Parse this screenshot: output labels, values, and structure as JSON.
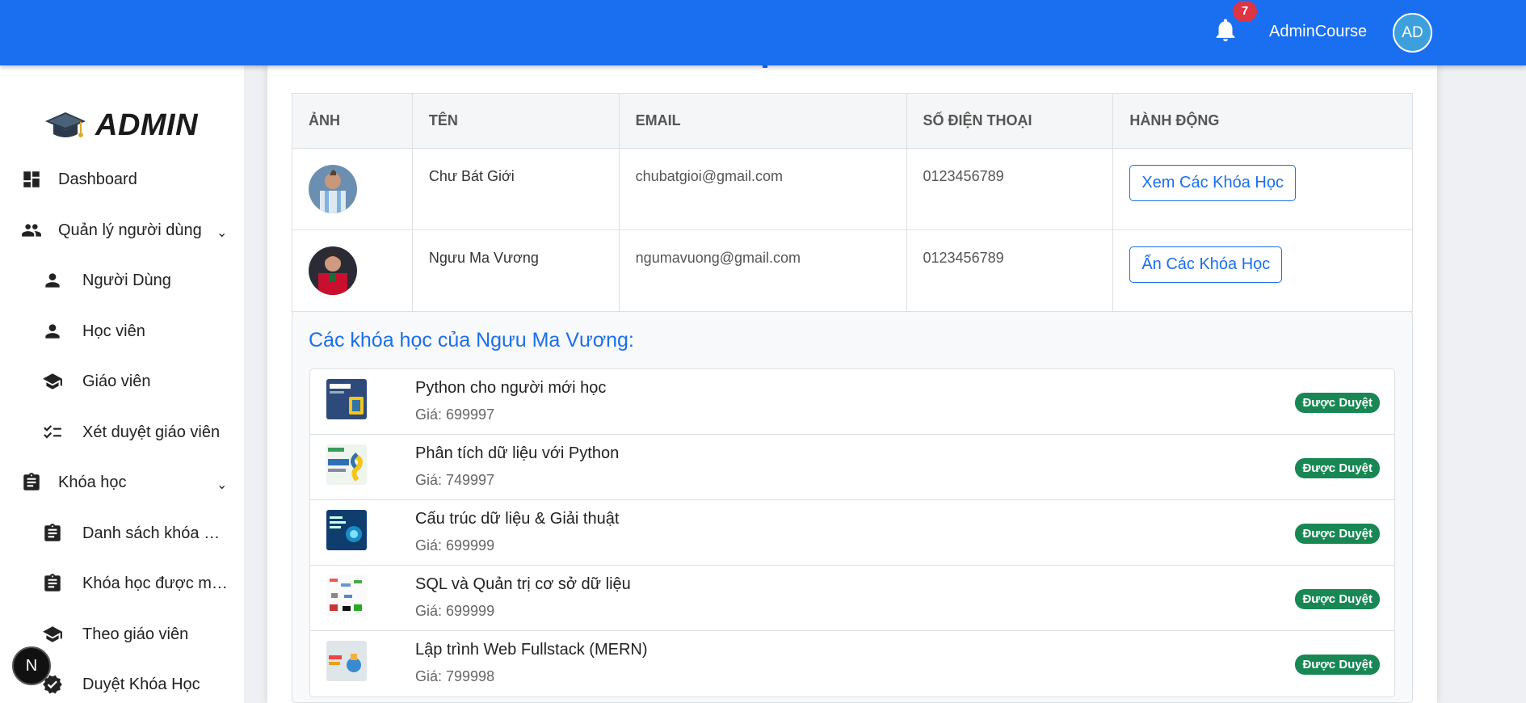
{
  "header": {
    "notification_count": "7",
    "admin_name": "AdminCourse",
    "avatar_initials": "AD",
    "brand_color": "#1a6ef0"
  },
  "sidebar": {
    "logo_text": "ADMIN",
    "items": [
      {
        "label": "Dashboard",
        "icon": "dashboard-icon"
      },
      {
        "label": "Quản lý người dùng",
        "icon": "people-icon",
        "expandable": true
      },
      {
        "label": "Người Dùng",
        "icon": "person-icon"
      },
      {
        "label": "Học viên",
        "icon": "person-icon"
      },
      {
        "label": "Giáo viên",
        "icon": "school-icon"
      },
      {
        "label": "Xét duyệt giáo viên",
        "icon": "checklist-icon"
      },
      {
        "label": "Khóa học",
        "icon": "clipboard-icon",
        "expandable": true
      },
      {
        "label": "Danh sách khóa …",
        "icon": "clipboard-icon"
      },
      {
        "label": "Khóa học được m…",
        "icon": "clipboard-icon"
      },
      {
        "label": "Theo giáo viên",
        "icon": "school-icon"
      },
      {
        "label": "Duyệt Khóa Học",
        "icon": "verified-icon"
      }
    ],
    "floating_badge": "N"
  },
  "table": {
    "headers": [
      "ẢNH",
      "TÊN",
      "EMAIL",
      "SỐ ĐIỆN THOẠI",
      "HÀNH ĐỘNG"
    ],
    "rows": [
      {
        "name": "Chư Bát Giới",
        "email": "chubatgioi@gmail.com",
        "phone": "0123456789",
        "action": "Xem Các Khóa Học"
      },
      {
        "name": "Ngưu Ma Vương",
        "email": "ngumavuong@gmail.com",
        "phone": "0123456789",
        "action": "Ẩn Các Khóa Học"
      }
    ]
  },
  "courses": {
    "title": "Các khóa học của Ngưu Ma Vương:",
    "items": [
      {
        "name": "Python cho người mới học",
        "price": "Giá: 699997",
        "status": "Được Duyệt"
      },
      {
        "name": "Phân tích dữ liệu với Python",
        "price": "Giá: 749997",
        "status": "Được Duyệt"
      },
      {
        "name": "Cấu trúc dữ liệu & Giải thuật",
        "price": "Giá: 699999",
        "status": "Được Duyệt"
      },
      {
        "name": "SQL và Quản trị cơ sở dữ liệu",
        "price": "Giá: 699999",
        "status": "Được Duyệt"
      },
      {
        "name": "Lập trình Web Fullstack (MERN)",
        "price": "Giá: 799998",
        "status": "Được Duyệt"
      }
    ],
    "status_color": "#198754"
  }
}
